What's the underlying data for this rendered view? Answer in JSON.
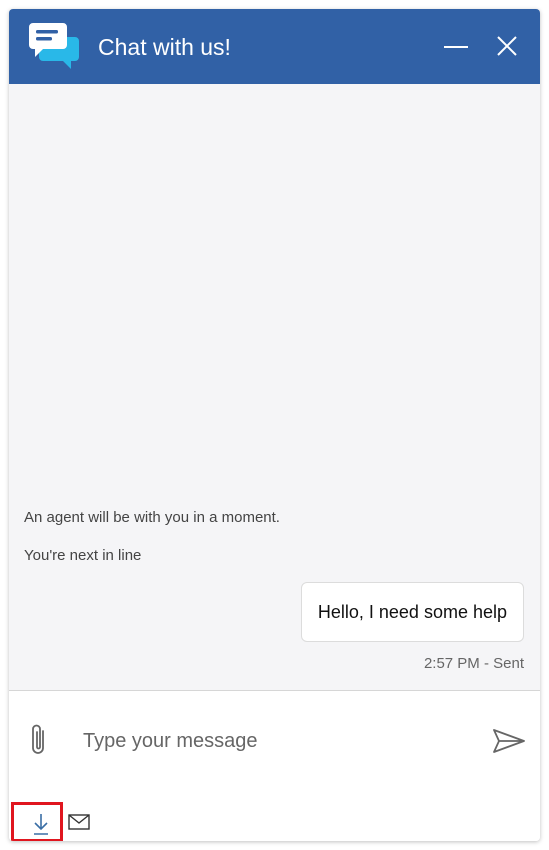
{
  "header": {
    "title": "Chat with us!",
    "background_color": "#3161a6",
    "logo_icon": "chat-bubbles-icon",
    "minimize_icon": "minimize-icon",
    "close_icon": "close-icon"
  },
  "messages": {
    "system": [
      "An agent will be with you in a moment.",
      "You're next in line"
    ],
    "outgoing": {
      "text": "Hello, I need some help",
      "meta": "2:57 PM - Sent"
    }
  },
  "composer": {
    "placeholder": "Type your message",
    "value": "",
    "attach_icon": "paperclip-icon",
    "send_icon": "send-icon",
    "download_icon": "download-transcript-icon",
    "email_icon": "email-transcript-icon",
    "highlight_color": "#e0161f"
  }
}
